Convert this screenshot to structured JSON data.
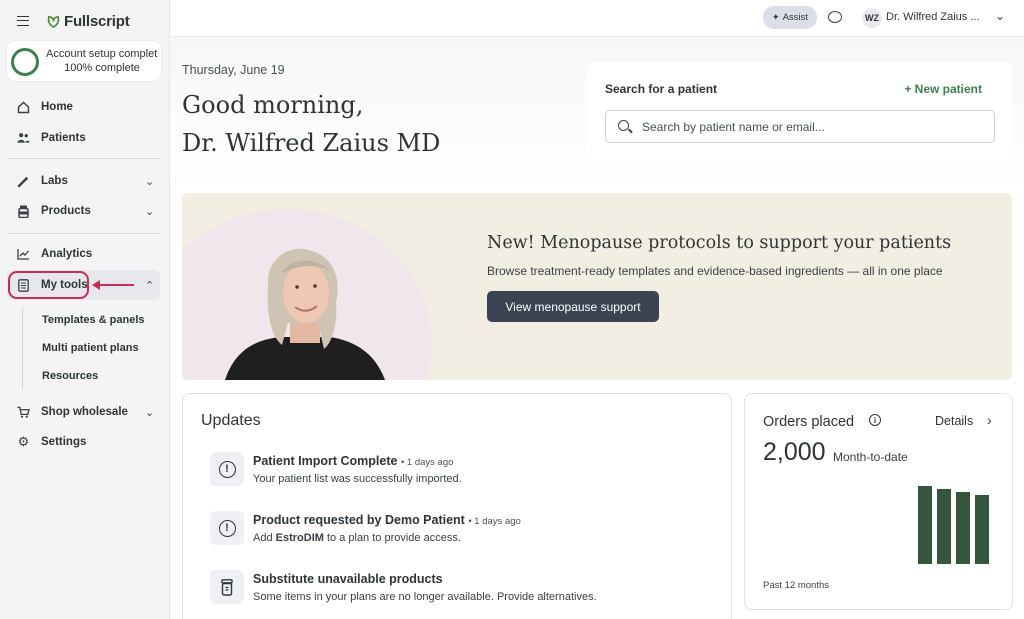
{
  "app": {
    "logo_text": "Fullscript"
  },
  "setup": {
    "title": "Account setup complet",
    "progress_label": "100% complete",
    "progress": 1.0
  },
  "nav": {
    "home": "Home",
    "patients": "Patients",
    "labs": "Labs",
    "products": "Products",
    "analytics": "Analytics",
    "my_tools": "My tools",
    "sub_items": [
      "Templates & panels",
      "Multi patient plans",
      "Resources"
    ],
    "shop_wholesale": "Shop wholesale",
    "settings": "Settings"
  },
  "topbar": {
    "assist_label": "Assist",
    "avatar_initials": "WZ",
    "user_name": "Dr. Wilfred Zaius ..."
  },
  "header": {
    "date": "Thursday, June 19",
    "greeting_line1": "Good morning,",
    "greeting_line2": "Dr. Wilfred Zaius MD"
  },
  "search": {
    "title": "Search for a patient",
    "new_patient": "+ New patient",
    "placeholder": "Search by patient name or email..."
  },
  "banner": {
    "title": "New! Menopause protocols to support your patients",
    "subtitle": "Browse treatment-ready templates and evidence-based ingredients — all in one place",
    "button": "View menopause support"
  },
  "updates": {
    "title": "Updates",
    "items": [
      {
        "title": "Patient Import Complete",
        "time": "• 1 days ago",
        "desc": "Your patient list was successfully imported."
      },
      {
        "title": "Product requested by Demo Patient",
        "time": "• 1 days ago",
        "desc_pre": "Add ",
        "desc_bold": "EstroDIM",
        "desc_post": " to a plan to provide access."
      },
      {
        "title": "Substitute unavailable products",
        "desc": "Some items in your plans are no longer available. Provide alternatives."
      }
    ]
  },
  "orders": {
    "title": "Orders placed",
    "details": "Details",
    "value": "2,000",
    "value_label": "Month-to-date",
    "footer": "Past 12 months"
  },
  "chart_data": {
    "type": "bar",
    "categories": [
      "",
      "",
      "",
      ""
    ],
    "values": [
      100,
      96,
      92,
      88
    ],
    "title": "",
    "xlabel": "",
    "ylabel": "",
    "ylim": [
      0,
      100
    ],
    "color": "#36553f"
  },
  "colors": {
    "accent": "#3e7f50",
    "highlight": "#c32f55",
    "button": "#3b4452",
    "bar": "#36553f"
  }
}
